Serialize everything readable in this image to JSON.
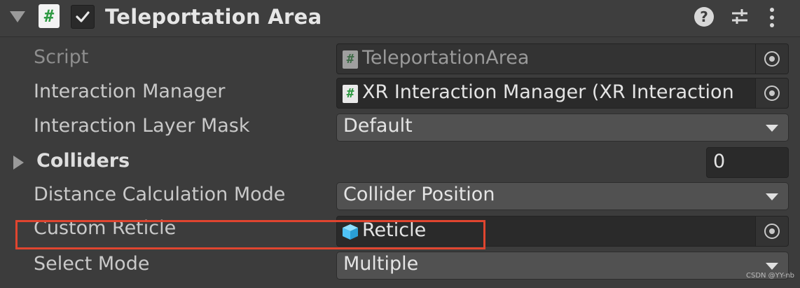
{
  "component": {
    "title": "Teleportation Area",
    "enabled": true,
    "icons": [
      "script-icon",
      "help-icon",
      "preset-icon",
      "context-menu-icon"
    ]
  },
  "fields": {
    "script": {
      "label": "Script",
      "value": "TeleportationArea"
    },
    "interaction_manager": {
      "label": "Interaction Manager",
      "value": "XR Interaction Manager (XR Interaction"
    },
    "interaction_layer_mask": {
      "label": "Interaction Layer Mask",
      "value": "Default"
    },
    "colliders": {
      "label": "Colliders",
      "count": "0"
    },
    "distance_calculation_mode": {
      "label": "Distance Calculation Mode",
      "value": "Collider Position"
    },
    "custom_reticle": {
      "label": "Custom Reticle",
      "value": "Reticle"
    },
    "select_mode": {
      "label": "Select Mode",
      "value": "Multiple"
    }
  },
  "help_glyph": "?",
  "script_glyph": "#",
  "watermark": "CSDN @YY-nb",
  "colors": {
    "background": "#3c3c3c",
    "field_dark": "#2a2a2a",
    "dropdown": "#515151",
    "highlight": "#e0452f",
    "script_green": "#2f9a43",
    "cube_blue": "#4fc3f7"
  }
}
